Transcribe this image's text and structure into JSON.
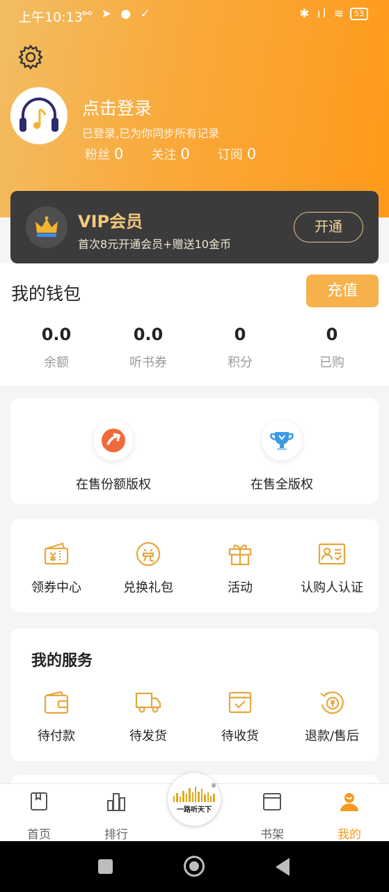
{
  "status_bar": {
    "time": "上午10:13",
    "left_icons": "⚯ ➤ ● ✓",
    "right_icons": "✱ ıl ≋",
    "battery": "53"
  },
  "profile": {
    "title": "点击登录",
    "subtitle": "已登录,已为你同步所有记录",
    "stats": [
      {
        "label": "粉丝",
        "value": "0"
      },
      {
        "label": "关注",
        "value": "0"
      },
      {
        "label": "订阅",
        "value": "0"
      }
    ]
  },
  "vip": {
    "title": "VIP会员",
    "subtitle": "首次8元开通会员+赠送10金币",
    "button": "开通",
    "accent": "#f3c97c"
  },
  "wallet": {
    "title": "我的钱包",
    "recharge": "充值",
    "items": [
      {
        "value": "0.0",
        "label": "余额"
      },
      {
        "value": "0.0",
        "label": "听书券"
      },
      {
        "value": "0",
        "label": "积分"
      },
      {
        "value": "0",
        "label": "已购"
      }
    ]
  },
  "copyright": {
    "items": [
      {
        "label": "在售份额版权",
        "icon": "arrow-up-circle-icon"
      },
      {
        "label": "在售全版权",
        "icon": "trophy-icon"
      }
    ]
  },
  "tools": {
    "items": [
      {
        "label": "领券中心",
        "icon": "coupon-icon"
      },
      {
        "label": "兑换礼包",
        "icon": "exchange-icon"
      },
      {
        "label": "活动",
        "icon": "gift-icon"
      },
      {
        "label": "认购人认证",
        "icon": "id-card-icon"
      }
    ]
  },
  "services": {
    "title": "我的服务",
    "items": [
      {
        "label": "待付款",
        "icon": "wallet-icon"
      },
      {
        "label": "待发货",
        "icon": "truck-icon"
      },
      {
        "label": "待收货",
        "icon": "box-check-icon"
      },
      {
        "label": "退款/售后",
        "icon": "refund-icon"
      }
    ]
  },
  "tabbar": {
    "items": [
      {
        "label": "首页"
      },
      {
        "label": "排行"
      },
      {
        "label": "书架"
      },
      {
        "label": "我的"
      }
    ],
    "logo_text": "一路听天下",
    "logo_reg": "®",
    "active_color": "#f59b1f"
  },
  "colors": {
    "header_start": "#f2bd63",
    "header_end": "#ff9a1a",
    "icon_gold": "#e6a73c"
  }
}
